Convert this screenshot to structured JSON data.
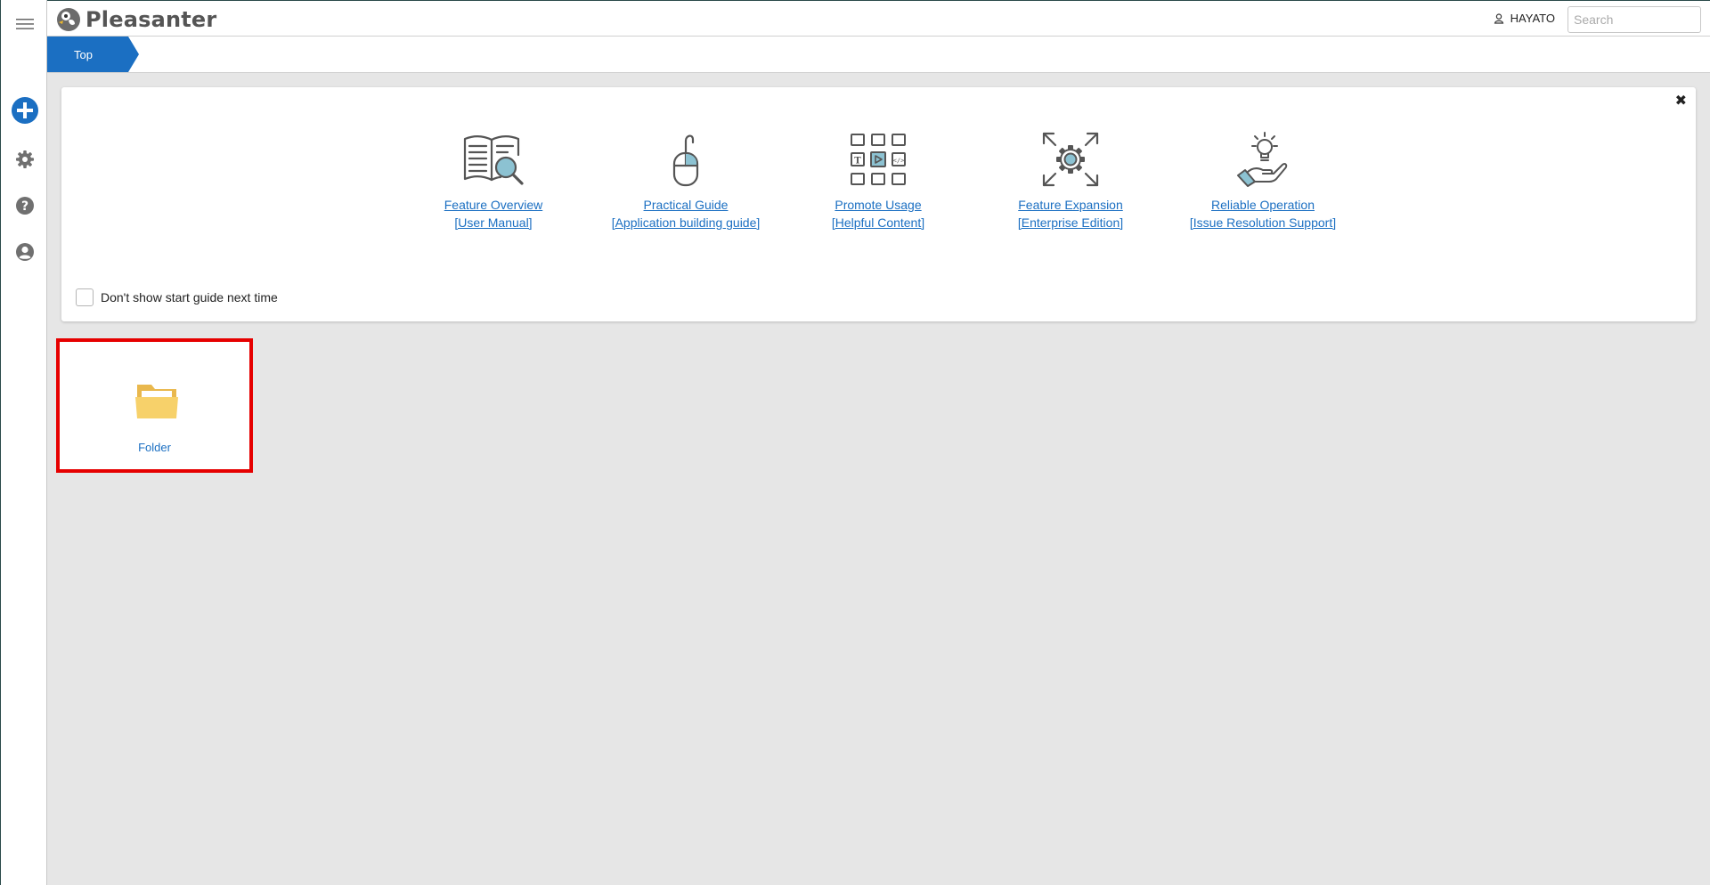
{
  "app": {
    "name": "Pleasanter"
  },
  "header": {
    "user_name": "HAYATO",
    "search_placeholder": "Search"
  },
  "breadcrumb": {
    "items": [
      "Top"
    ]
  },
  "guide": {
    "items": [
      {
        "title": "Feature Overview",
        "subtitle": "[User Manual]",
        "icon": "book-search-icon"
      },
      {
        "title": "Practical Guide",
        "subtitle": "[Application building guide]",
        "icon": "mouse-icon"
      },
      {
        "title": "Promote Usage",
        "subtitle": "[Helpful Content]",
        "icon": "content-grid-icon"
      },
      {
        "title": "Feature Expansion",
        "subtitle": "[Enterprise Edition]",
        "icon": "expand-gear-icon"
      },
      {
        "title": "Reliable Operation",
        "subtitle": "[Issue Resolution Support]",
        "icon": "hand-lightbulb-icon"
      }
    ],
    "checkbox_label": "Don't show start guide next time",
    "checkbox_checked": false
  },
  "sites": [
    {
      "label": "Folder",
      "icon": "folder-icon"
    }
  ],
  "colors": {
    "accent": "#1b6fc2",
    "icon_teal": "#8cc2d2",
    "folder": "#f7d16a",
    "highlight": "#e60000"
  }
}
